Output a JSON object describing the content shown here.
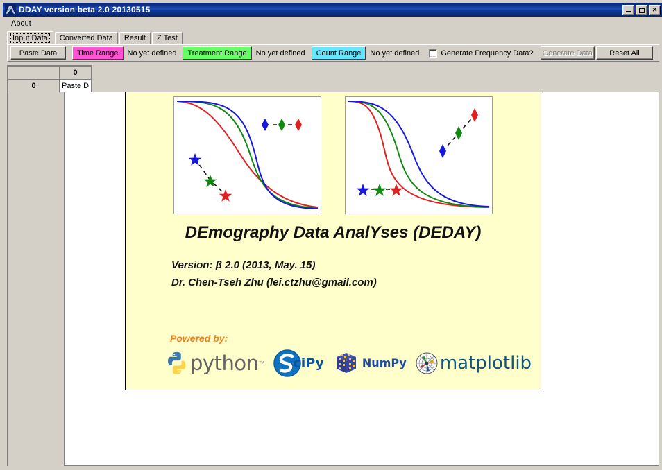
{
  "window": {
    "title": "DDAY version beta 2.0 20130515",
    "icon": "app-curve-icon",
    "buttons": {
      "minimize": "minimize-button",
      "maximize": "maximize-button",
      "close": "✕"
    }
  },
  "menu": {
    "items": [
      {
        "label": "About"
      }
    ]
  },
  "tabs": [
    {
      "label": "Input Data",
      "active": true
    },
    {
      "label": "Converted Data",
      "active": false
    },
    {
      "label": "Result",
      "active": false
    },
    {
      "label": "Z Test",
      "active": false
    }
  ],
  "toolbar": {
    "paste_data": "Paste Data",
    "time_range": "Time Range",
    "time_range_color": "#ff55d5",
    "time_range_status": "No yet defined",
    "treatment_range": "Treatment Range",
    "treatment_range_color": "#66ff66",
    "treatment_range_status": "No yet defined",
    "count_range": "Count Range",
    "count_range_color": "#66e5ff",
    "count_range_status": "No yet defined",
    "generate_frequency_label": "Generate Frequency Data?",
    "generate_frequency_checked": false,
    "generate_data": "Generate Data",
    "generate_data_enabled": false,
    "reset_all": "Reset All"
  },
  "grid": {
    "corner": "",
    "column_headers": [
      "0"
    ],
    "row_headers": [
      "0"
    ],
    "cells": [
      [
        "Paste D"
      ]
    ]
  },
  "splash": {
    "title": "DEmography Data AnalYses (DEDAY)",
    "version": "Version:  β 2.0 (2013, May. 15)",
    "author": "Dr. Chen-Tseh Zhu (lei.ctzhu@gmail.com)",
    "powered_by": "Powered by:",
    "background": "#ffffcc",
    "logos": [
      {
        "name": "python-logo",
        "text": "python",
        "tm": "™"
      },
      {
        "name": "scipy-logo",
        "text": "ciPy"
      },
      {
        "name": "numpy-logo",
        "text": "NumPy"
      },
      {
        "name": "matplotlib-logo",
        "text": "matplotlib"
      }
    ],
    "chart_data": [
      {
        "type": "line",
        "title": "left-thumbnail-plot",
        "series": [
          {
            "name": "curve-red",
            "color": "#e02020",
            "midpoint": 0.46,
            "steepness": 5
          },
          {
            "name": "curve-green",
            "color": "#118811",
            "midpoint": 0.6,
            "steepness": 14
          },
          {
            "name": "curve-blue",
            "color": "#1818dd",
            "midpoint": 0.64,
            "steepness": 20
          },
          {
            "name": "diamond-markers",
            "marker": "diamond",
            "points": [
              [
                0.62,
                0.8
              ],
              [
                0.73,
                0.8
              ],
              [
                0.84,
                0.8
              ]
            ],
            "colors": [
              "#1818dd",
              "#118811",
              "#e02020"
            ]
          },
          {
            "name": "star-markers",
            "marker": "star",
            "points": [
              [
                0.14,
                0.4
              ],
              [
                0.28,
                0.2
              ],
              [
                0.4,
                0.095
              ]
            ],
            "colors": [
              "#1818dd",
              "#118811",
              "#e02020"
            ]
          }
        ],
        "grid": false,
        "legend": "none",
        "xlim": [
          0,
          1
        ],
        "ylim": [
          0,
          1
        ]
      },
      {
        "type": "line",
        "title": "right-thumbnail-plot",
        "series": [
          {
            "name": "curve-red",
            "color": "#e02020",
            "midpoint": 0.33,
            "steepness": 13
          },
          {
            "name": "curve-green",
            "color": "#118811",
            "midpoint": 0.44,
            "steepness": 11
          },
          {
            "name": "curve-blue",
            "color": "#1818dd",
            "midpoint": 0.56,
            "steepness": 10
          },
          {
            "name": "diamond-markers",
            "marker": "diamond",
            "points": [
              [
                0.66,
                0.52
              ],
              [
                0.78,
                0.71
              ],
              [
                0.89,
                0.88
              ]
            ],
            "colors": [
              "#1818dd",
              "#118811",
              "#e02020"
            ]
          },
          {
            "name": "star-markers",
            "marker": "star",
            "points": [
              [
                0.08,
                0.19
              ],
              [
                0.2,
                0.19
              ],
              [
                0.31,
                0.19
              ]
            ],
            "colors": [
              "#1818dd",
              "#118811",
              "#e02020"
            ]
          }
        ],
        "grid": false,
        "legend": "none",
        "xlim": [
          0,
          1
        ],
        "ylim": [
          0,
          1
        ]
      }
    ]
  }
}
